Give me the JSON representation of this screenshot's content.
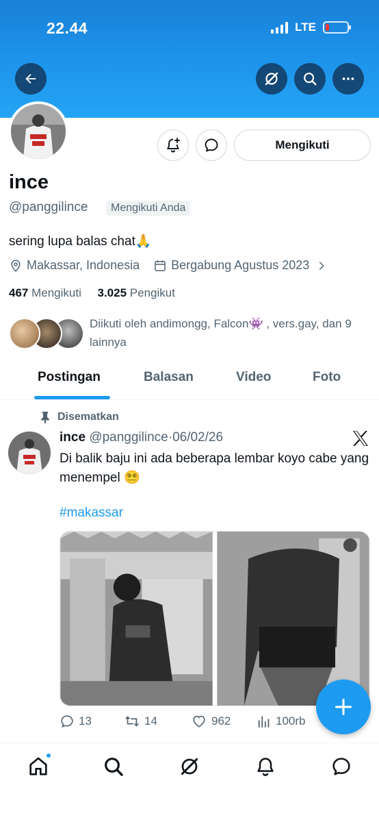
{
  "status_bar": {
    "time": "22.44",
    "network": "LTE",
    "battery_level": 0.15
  },
  "header": {
    "back_icon": "arrow-left-icon",
    "grok_icon": "grok-slash-icon",
    "search_icon": "search-icon",
    "more_icon": "more-dots-icon"
  },
  "profile": {
    "display_name": "ince",
    "handle": "@panggilince",
    "follows_you": "Mengikuti Anda",
    "follow_button": "Mengikuti",
    "bio": "sering lupa balas chat🙏",
    "location": "Makassar, Indonesia",
    "joined": "Bergabung Agustus 2023",
    "following_count": "467",
    "following_label": "Mengikuti",
    "followers_count": "3.025",
    "followers_label": "Pengikut",
    "followed_by": "Diikuti oleh andimongg, Falcon👾 , vers.gay, dan 9 lainnya"
  },
  "tabs": [
    {
      "label": "Postingan",
      "active": true
    },
    {
      "label": "Balasan",
      "active": false
    },
    {
      "label": "Video",
      "active": false
    },
    {
      "label": "Foto",
      "active": false
    }
  ],
  "post": {
    "pinned_label": "Disematkan",
    "author": "ince",
    "handle": "@panggilince",
    "separator": "·",
    "date": "06/02/26",
    "text": "Di balik baju ini ada beberapa lembar koyo cabe yang menempel 😵‍💫",
    "hashtag": "#makassar",
    "replies": "13",
    "reposts": "14",
    "likes": "962",
    "views": "100rb"
  },
  "bottom_nav": [
    "home-icon",
    "search-icon",
    "grok-icon",
    "bell-icon",
    "messages-icon"
  ],
  "colors": {
    "accent": "#1d9bf0",
    "banner": "#1d95ec",
    "text": "#0f1419",
    "muted": "#536471"
  }
}
